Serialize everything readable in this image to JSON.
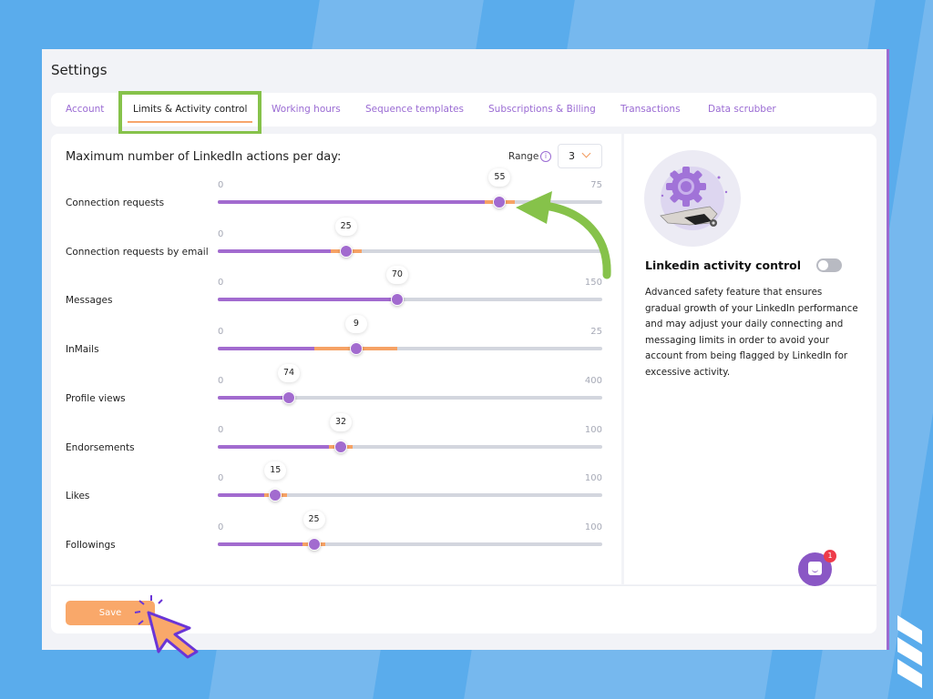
{
  "page": {
    "title": "Settings"
  },
  "tabs": [
    {
      "label": "Account",
      "active": false
    },
    {
      "label": "Limits & Activity control",
      "active": true
    },
    {
      "label": "Working hours",
      "active": false
    },
    {
      "label": "Sequence templates",
      "active": false
    },
    {
      "label": "Subscriptions & Billing",
      "active": false
    },
    {
      "label": "Transactions",
      "active": false
    },
    {
      "label": "Data scrubber",
      "active": false
    }
  ],
  "limits": {
    "title": "Maximum number of LinkedIn actions per day:",
    "range_label": "Range",
    "range_value": "3",
    "sliders": [
      {
        "label": "Connection requests",
        "min": 0,
        "max": 75,
        "value": 55,
        "safe_low": 52,
        "safe_high": 58
      },
      {
        "label": "Connection requests by email",
        "min": 0,
        "max": "",
        "scale_max": 75,
        "value": 25,
        "safe_low": 22,
        "safe_high": 28
      },
      {
        "label": "Messages",
        "min": 0,
        "max": 150,
        "value": 70,
        "safe_low": null,
        "safe_high": null
      },
      {
        "label": "InMails",
        "min": 0,
        "max": 25,
        "value": 9,
        "safe_low": 6.3,
        "safe_high": 11.7
      },
      {
        "label": "Profile views",
        "min": 0,
        "max": 400,
        "value": 74,
        "safe_low": null,
        "safe_high": null
      },
      {
        "label": "Endorsements",
        "min": 0,
        "max": 100,
        "value": 32,
        "safe_low": 29,
        "safe_high": 35
      },
      {
        "label": "Likes",
        "min": 0,
        "max": 100,
        "value": 15,
        "safe_low": 12,
        "safe_high": 18
      },
      {
        "label": "Followings",
        "min": 0,
        "max": 100,
        "value": 25,
        "safe_low": 22,
        "safe_high": 28
      }
    ]
  },
  "activity_control": {
    "title": "Linkedin activity control",
    "enabled": false,
    "description": "Advanced safety feature that ensures gradual growth of your LinkedIn performance and may adjust your daily connecting and messaging limits in order to avoid your account from being flagged by LinkedIn for excessive activity."
  },
  "footer": {
    "save_label": "Save"
  },
  "chat": {
    "badge_count": "1"
  },
  "colors": {
    "accent": "#9a6bd3",
    "orange": "#f7a56a",
    "highlight": "#86c24a",
    "background": "#5aacec"
  }
}
